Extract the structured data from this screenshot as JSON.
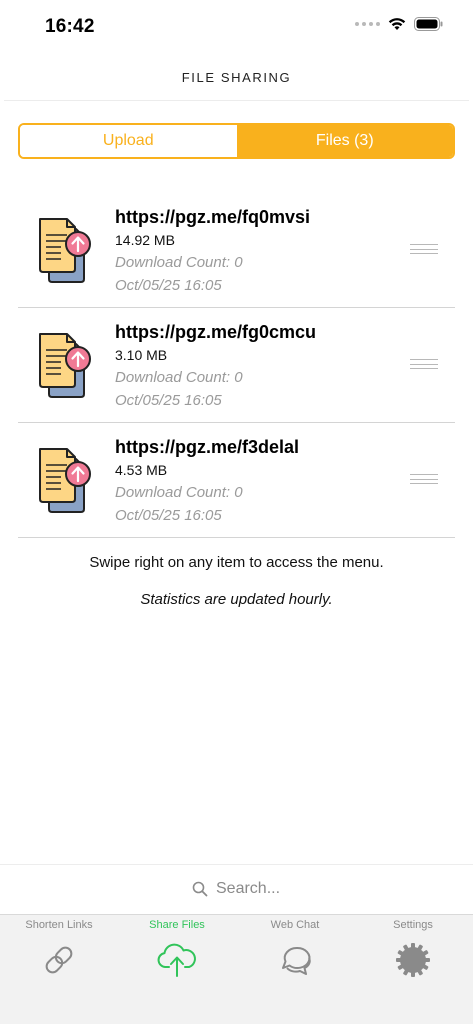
{
  "status_bar": {
    "time": "16:42"
  },
  "nav": {
    "title": "FILE SHARING"
  },
  "segments": {
    "upload_label": "Upload",
    "files_label": "Files (3)"
  },
  "files": [
    {
      "url": "https://pgz.me/fq0mvsi",
      "size": "14.92 MB",
      "download_count": "Download Count: 0",
      "date": "Oct/05/25 16:05"
    },
    {
      "url": "https://pgz.me/fg0cmcu",
      "size": "3.10 MB",
      "download_count": "Download Count: 0",
      "date": "Oct/05/25 16:05"
    },
    {
      "url": "https://pgz.me/f3delal",
      "size": "4.53 MB",
      "download_count": "Download Count: 0",
      "date": "Oct/05/25 16:05"
    }
  ],
  "hint_text": "Swipe right on any item to access the menu.",
  "stats_note": "Statistics are updated hourly.",
  "search": {
    "placeholder": "Search..."
  },
  "tabs": [
    {
      "label": "Shorten Links",
      "icon": "link-icon"
    },
    {
      "label": "Share Files",
      "icon": "cloud-upload-icon",
      "active": true
    },
    {
      "label": "Web Chat",
      "icon": "chat-bubbles-icon"
    },
    {
      "label": "Settings",
      "icon": "gear-icon"
    }
  ],
  "colors": {
    "accent": "#f9b11d",
    "active_tab": "#31c45a",
    "file_paper": "#fdd685",
    "file_back": "#8aa2c6",
    "upload_badge": "#f07a95"
  }
}
